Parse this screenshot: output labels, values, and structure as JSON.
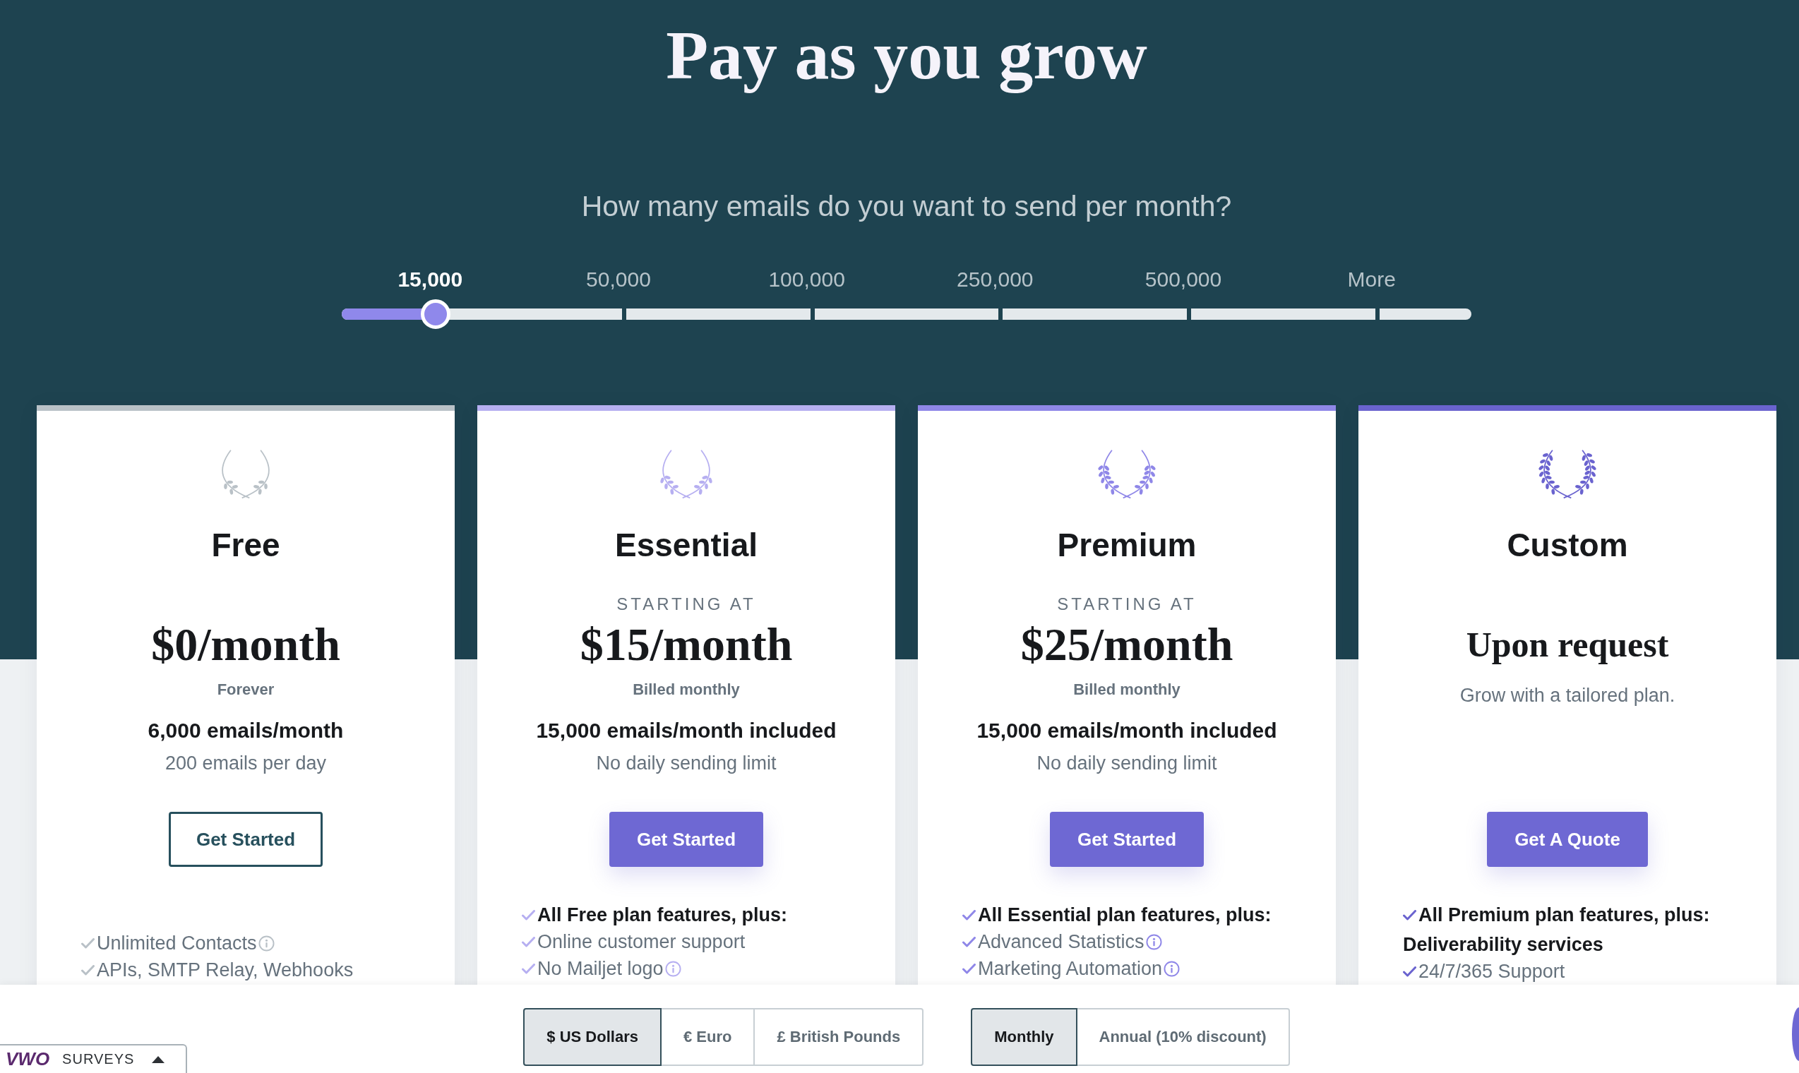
{
  "header": {
    "title": "Pay as you grow",
    "question": "How many emails do you want to send per month?"
  },
  "slider": {
    "stops": [
      {
        "label": "15,000",
        "selected": true
      },
      {
        "label": "50,000",
        "selected": false
      },
      {
        "label": "100,000",
        "selected": false
      },
      {
        "label": "250,000",
        "selected": false
      },
      {
        "label": "500,000",
        "selected": false
      },
      {
        "label": "More",
        "selected": false
      }
    ],
    "level": 0.083
  },
  "plans": [
    {
      "kind": "fixed",
      "name": "Free",
      "color": "#b9c1c7",
      "price": "$0/month",
      "price_note": "Forever",
      "emails": "6,000 emails/month",
      "limit": "200 emails per day",
      "button": {
        "label": "Get Started",
        "kind": "outline"
      },
      "features": [
        {
          "kind": "item",
          "text": "Unlimited Contacts",
          "info": true
        },
        {
          "kind": "item",
          "text": "APIs, SMTP Relay, Webhooks",
          "info": false
        }
      ]
    },
    {
      "kind": "fixed",
      "name": "Essential",
      "color": "#b6aff1",
      "price_caption": "STARTING AT",
      "price": "$15/month",
      "price_note": "Billed monthly",
      "emails": "15,000 emails/month included",
      "limit": "No daily sending limit",
      "button": {
        "label": "Get Started",
        "kind": "filled"
      },
      "features": [
        {
          "kind": "heading",
          "text": "All Free plan features, plus:",
          "info": false
        },
        {
          "kind": "item",
          "text": "Online customer support",
          "info": false
        },
        {
          "kind": "item",
          "text": "No Mailjet logo",
          "info": true
        }
      ]
    },
    {
      "kind": "fixed",
      "name": "Premium",
      "color": "#8f87e8",
      "price_caption": "STARTING AT",
      "price": "$25/month",
      "price_note": "Billed monthly",
      "emails": "15,000 emails/month included",
      "limit": "No daily sending limit",
      "button": {
        "label": "Get Started",
        "kind": "filled"
      },
      "features": [
        {
          "kind": "heading",
          "text": "All Essential plan features, plus:",
          "info": false
        },
        {
          "kind": "item",
          "text": "Advanced Statistics",
          "info": true
        },
        {
          "kind": "item",
          "text": "Marketing Automation",
          "info": true
        }
      ]
    },
    {
      "kind": "quote",
      "name": "Custom",
      "color": "#6a63cf",
      "price": "Upon request",
      "tagline": "Grow with a tailored plan.",
      "button": {
        "label": "Get A Quote",
        "kind": "filled"
      },
      "features": [
        {
          "kind": "heading",
          "text": "All Premium plan features, plus:",
          "info": false
        },
        {
          "kind": "section",
          "text": "Deliverability services",
          "info": false
        },
        {
          "kind": "item",
          "text": "24/7/365 Support",
          "info": false
        }
      ]
    }
  ],
  "currency_toggle": [
    {
      "label": "$ US Dollars",
      "selected": true
    },
    {
      "label": "€ Euro",
      "selected": false
    },
    {
      "label": "£ British Pounds",
      "selected": false
    }
  ],
  "billing_toggle": [
    {
      "label": "Monthly",
      "selected": true
    },
    {
      "label": "Annual (10% discount)",
      "selected": false
    }
  ],
  "survey_widget": {
    "logo": "VWO",
    "label": "SURVEYS"
  }
}
